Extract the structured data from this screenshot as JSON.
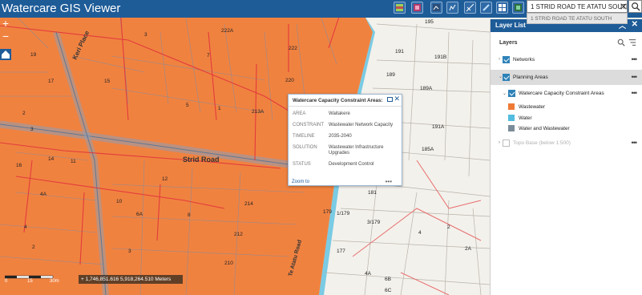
{
  "app": {
    "title": "Watercare GIS Viewer"
  },
  "search": {
    "value": "1 STRID ROAD TE ATATU SOUTH",
    "suggestion": "1 STRID ROAD TE ATATU SOUTH"
  },
  "toolbar": {
    "icons": [
      "layers-icon",
      "legend-icon",
      "basemap-icon",
      "chart-icon",
      "measure-icon",
      "draw-icon",
      "print-icon",
      "grid-icon"
    ]
  },
  "map": {
    "street_labels": [
      "Keri Place",
      "Strid Road",
      "Te Atatu Road"
    ],
    "parcel_labels": [
      "3",
      "222A",
      "19",
      "7",
      "17",
      "15",
      "222",
      "220",
      "5",
      "1",
      "2",
      "3",
      "213A",
      "16",
      "14",
      "11",
      "4A",
      "10",
      "12",
      "214",
      "6A",
      "8",
      "4",
      "212",
      "2",
      "3",
      "210",
      "1/179",
      "179",
      "3/179",
      "177",
      "4",
      "2",
      "2A",
      "4A",
      "6B",
      "6C",
      "181",
      "185A",
      "191A",
      "189A",
      "189",
      "191",
      "191B",
      "195"
    ]
  },
  "popup": {
    "title": "Watercare Capacity Constraint Areas:",
    "rows": [
      {
        "label": "AREA",
        "value": "Waitakere"
      },
      {
        "label": "CONSTRAINT",
        "value": "Wastewater Network Capacity"
      },
      {
        "label": "TIMELINE",
        "value": "2035-2040"
      },
      {
        "label": "SOLUTION",
        "value": "Wastewater Infrastructure Upgrades"
      },
      {
        "label": "STATUS",
        "value": "Development Control"
      }
    ],
    "zoom_to": "Zoom to",
    "more": "•••"
  },
  "layer_list": {
    "title": "Layer List",
    "heading": "Layers",
    "items": [
      {
        "label": "Networks",
        "checked": true
      },
      {
        "label": "Planning Areas",
        "checked": true
      },
      {
        "label": "Watercare Capacity Constraint Areas",
        "checked": true
      },
      {
        "label": "Topo Base (below 1:500)",
        "checked": false
      }
    ],
    "legend": [
      {
        "label": "Wastewater",
        "color": "#ef7a35"
      },
      {
        "label": "Water",
        "color": "#52bde0"
      },
      {
        "label": "Water and Wastewater",
        "color": "#7a8c99"
      }
    ],
    "more": "•••"
  },
  "scale": {
    "labels": [
      "0",
      "15",
      "30m"
    ]
  },
  "coordinates": {
    "text": "1,746,851.616 5,918,264.510 Meters"
  },
  "colors": {
    "header": "#1e5c98",
    "constraint": "#ef7a35",
    "water": "#52bde0",
    "basemap": "#f3f1ec"
  }
}
